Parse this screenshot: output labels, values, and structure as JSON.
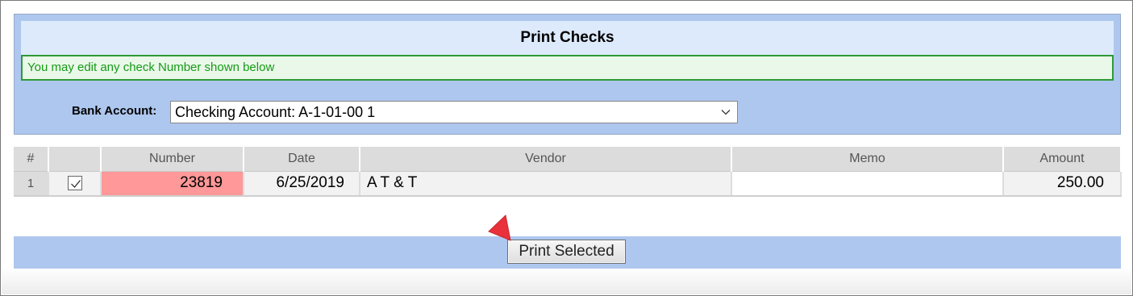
{
  "panel": {
    "title": "Print Checks",
    "notice": "You may edit any check Number shown below",
    "bank_label": "Bank Account:",
    "bank_value": "Checking Account: A-1-01-00 1"
  },
  "table": {
    "columns": [
      "#",
      "",
      "Number",
      "Date",
      "Vendor",
      "Memo",
      "Amount"
    ],
    "rows": [
      {
        "index": "1",
        "checked": "true",
        "number": "23819",
        "date": "6/25/2019",
        "vendor": "A T & T",
        "memo": "",
        "amount": "250.00"
      }
    ]
  },
  "actions": {
    "print_label": "Print Selected"
  },
  "colors": {
    "panel_bg": "#aec7ee",
    "title_bg": "#ddeafc",
    "notice_border": "#2e9a35",
    "notice_text": "#179a17",
    "number_cell": "#ff9898",
    "pointer": "#e8313a"
  },
  "icons": {
    "dropdown": "chevron-down-icon",
    "checkbox": "check-icon",
    "pointer": "arrow-pointer-icon"
  }
}
